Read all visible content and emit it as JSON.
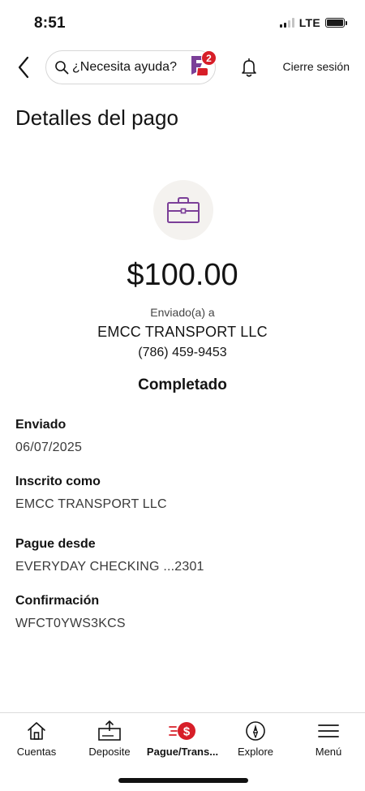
{
  "status_bar": {
    "time": "8:51",
    "network": "LTE"
  },
  "header": {
    "search_placeholder": "¿Necesita ayuda?",
    "fargo_notification_count": "2",
    "logout_label": "Cierre sesión"
  },
  "page": {
    "title": "Detalles del pago"
  },
  "payment": {
    "icon": "briefcase-icon",
    "amount": "$100.00",
    "sent_to_label": "Enviado(a) a",
    "recipient_name": "EMCC TRANSPORT LLC",
    "recipient_phone": "(786) 459-9453",
    "status": "Completado"
  },
  "details": [
    {
      "label": "Enviado",
      "value": "06/07/2025"
    },
    {
      "label": "Inscrito como",
      "value": "EMCC TRANSPORT LLC"
    },
    {
      "label": "Pague desde",
      "value": "EVERYDAY CHECKING ...2301"
    },
    {
      "label": "Confirmación",
      "value": "WFCT0YWS3KCS"
    }
  ],
  "tab_bar": {
    "items": [
      {
        "label": "Cuentas",
        "icon": "house-icon"
      },
      {
        "label": "Deposite",
        "icon": "deposit-icon"
      },
      {
        "label": "Pague/Trans...",
        "icon": "pay-transfer-icon",
        "active": true
      },
      {
        "label": "Explore",
        "icon": "compass-icon"
      },
      {
        "label": "Menú",
        "icon": "hamburger-menu-icon"
      }
    ]
  },
  "colors": {
    "brand_red": "#d71e28",
    "accent_purple": "#7b3f98",
    "icon_bg": "#f4f2ef"
  }
}
